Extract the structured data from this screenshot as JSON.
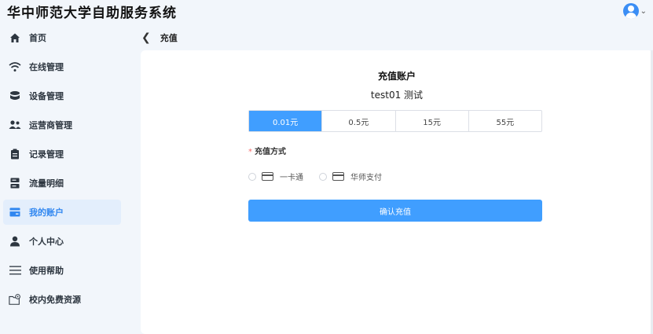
{
  "header": {
    "app_title": "华中师范大学自助服务系统"
  },
  "sidebar": {
    "items": [
      {
        "label": "首页",
        "icon": "home-icon"
      },
      {
        "label": "在线管理",
        "icon": "wifi-icon"
      },
      {
        "label": "设备管理",
        "icon": "database-icon"
      },
      {
        "label": "运营商管理",
        "icon": "users-icon"
      },
      {
        "label": "记录管理",
        "icon": "clipboard-icon"
      },
      {
        "label": "流量明细",
        "icon": "server-icon"
      },
      {
        "label": "我的账户",
        "icon": "wallet-icon",
        "active": true
      },
      {
        "label": "个人中心",
        "icon": "person-icon"
      },
      {
        "label": "使用帮助",
        "icon": "menu-icon"
      },
      {
        "label": "校内免费资源",
        "icon": "folder-settings-icon"
      }
    ]
  },
  "breadcrumb": {
    "label": "充值"
  },
  "recharge": {
    "title": "充值账户",
    "account": "test01 测试",
    "amounts": [
      "0.01元",
      "0.5元",
      "15元",
      "55元"
    ],
    "selected_amount": "0.01元",
    "method_label": "充值方式",
    "required_mark": "*",
    "methods": [
      "一卡通",
      "华师支付"
    ],
    "confirm_label": "确认充值"
  },
  "colors": {
    "accent": "#409eff",
    "active_nav_bg": "#e3eefc",
    "required": "#f56c6c"
  }
}
